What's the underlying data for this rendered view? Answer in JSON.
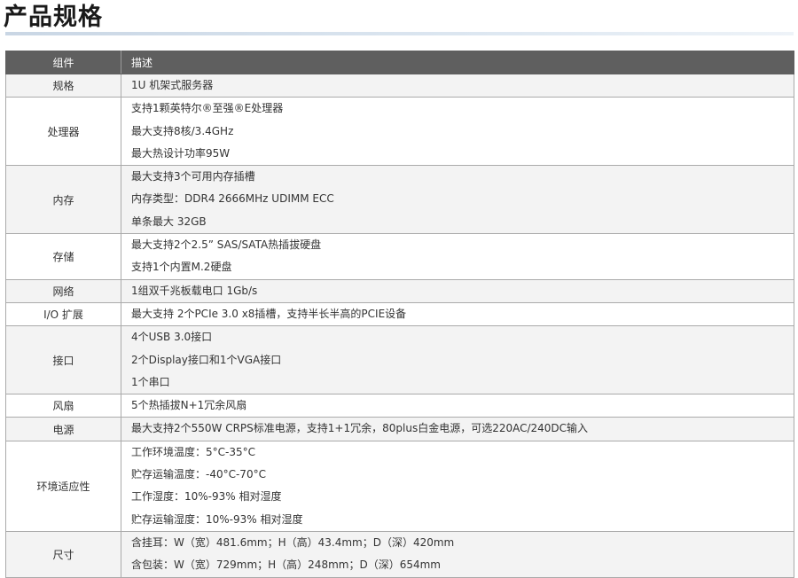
{
  "page": {
    "title": "产品规格"
  },
  "table": {
    "headers": {
      "component": "组件",
      "description": "描述"
    },
    "rows": [
      {
        "component": "规格",
        "lines": [
          "1U 机架式服务器"
        ]
      },
      {
        "component": "处理器",
        "lines": [
          "支持1颗英特尔®至强®E处理器",
          "最大支持8核/3.4GHz",
          "最大热设计功率95W"
        ]
      },
      {
        "component": "内存",
        "lines": [
          "最大支持3个可用内存插槽",
          "内存类型：DDR4 2666MHz UDIMM ECC",
          "单条最大 32GB"
        ]
      },
      {
        "component": "存储",
        "lines": [
          "最大支持2个2.5” SAS/SATA热插拔硬盘",
          "支持1个内置M.2硬盘"
        ]
      },
      {
        "component": "网络",
        "lines": [
          "1组双千兆板载电口 1Gb/s"
        ]
      },
      {
        "component": "I/O 扩展",
        "lines": [
          "最大支持 2个PCIe 3.0 x8插槽，支持半长半高的PCIE设备"
        ]
      },
      {
        "component": "接口",
        "lines": [
          "4个USB 3.0接口",
          "2个Display接口和1个VGA接口",
          "1个串口"
        ]
      },
      {
        "component": "风扇",
        "lines": [
          "5个热插拔N+1冗余风扇"
        ]
      },
      {
        "component": "电源",
        "lines": [
          "最大支持2个550W CRPS标准电源，支持1+1冗余，80plus白金电源，可选220AC/240DC输入"
        ]
      },
      {
        "component": "环境适应性",
        "lines": [
          "工作环境温度：5°C-35°C",
          "贮存运输温度：-40°C-70°C",
          "工作湿度：10%-93% 相对湿度",
          "贮存运输湿度：10%-93% 相对湿度"
        ]
      },
      {
        "component": "尺寸",
        "lines": [
          "含挂耳：W（宽）481.6mm；H（高）43.4mm；D（深）420mm",
          "含包装：W（宽）729mm；H（高）248mm；D（深）654mm"
        ]
      }
    ]
  }
}
